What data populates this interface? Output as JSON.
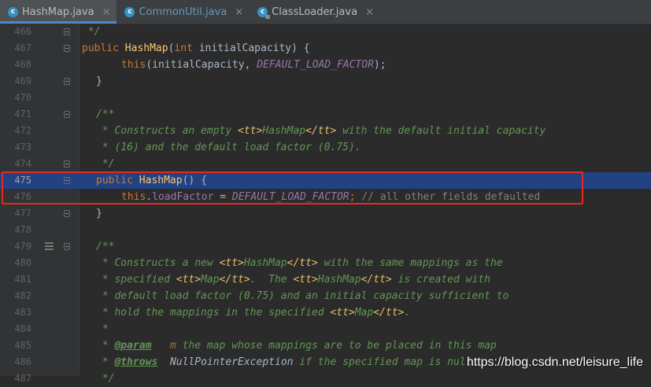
{
  "tabs": [
    {
      "label": "HashMap.java",
      "icon": "class-icon",
      "active": true
    },
    {
      "label": "CommonUtil.java",
      "icon": "class-icon",
      "active": false
    },
    {
      "label": "ClassLoader.java",
      "icon": "locked-class-icon",
      "active": false
    }
  ],
  "tab_close_glyph": "×",
  "lines": [
    {
      "num": "466"
    },
    {
      "num": "467"
    },
    {
      "num": "468"
    },
    {
      "num": "469"
    },
    {
      "num": "470"
    },
    {
      "num": "471"
    },
    {
      "num": "472"
    },
    {
      "num": "473"
    },
    {
      "num": "474"
    },
    {
      "num": "475"
    },
    {
      "num": "476"
    },
    {
      "num": "477"
    },
    {
      "num": "478"
    },
    {
      "num": "479"
    },
    {
      "num": "480"
    },
    {
      "num": "481"
    },
    {
      "num": "482"
    },
    {
      "num": "483"
    },
    {
      "num": "484"
    },
    {
      "num": "485"
    },
    {
      "num": "486"
    },
    {
      "num": "487"
    }
  ],
  "code": {
    "l466": " */",
    "l467_kw": "public ",
    "l467_fn": "HashMap",
    "l467_rest1": "(",
    "l467_kw2": "int ",
    "l467_rest2": "initialCapacity) {",
    "l468_kw": "this",
    "l468_rest1": "(initialCapacity, ",
    "l468_const": "DEFAULT_LOAD_FACTOR",
    "l468_rest2": ");",
    "l469": "}",
    "l471": "/**",
    "l472_a": " * Constructs an empty ",
    "l472_tt1": "<tt>",
    "l472_b": "HashMap",
    "l472_tt2": "</tt>",
    "l472_c": " with the default initial capacity",
    "l473": " * (16) and the default load factor (0.75).",
    "l474": " */",
    "l475_kw": "public ",
    "l475_fn": "HashMap",
    "l475_rest": "() {",
    "l476_kw": "this",
    "l476_dot": ".",
    "l476_field": "loadFactor",
    "l476_eq": " = ",
    "l476_const": "DEFAULT_LOAD_FACTOR",
    "l476_semi": "; ",
    "l476_cm": "// all other fields defaulted",
    "l477": "}",
    "l479": "/**",
    "l480_a": " * Constructs a new ",
    "l480_tt1": "<tt>",
    "l480_b": "HashMap",
    "l480_tt2": "</tt>",
    "l480_c": " with the same mappings as the",
    "l481_a": " * specified ",
    "l481_tt1": "<tt>",
    "l481_b": "Map",
    "l481_tt2": "</tt>",
    "l481_c": ".  The ",
    "l481_tt3": "<tt>",
    "l481_d": "HashMap",
    "l481_tt4": "</tt>",
    "l481_e": " is created with",
    "l482": " * default load factor (0.75) and an initial capacity sufficient to",
    "l483_a": " * hold the mappings in the specified ",
    "l483_tt1": "<tt>",
    "l483_b": "Map",
    "l483_tt2": "</tt>",
    "l483_c": ".",
    "l484": " *",
    "l485_a": " * ",
    "l485_ann": "@param",
    "l485_sp": "   ",
    "l485_p": "m",
    "l485_c": " the map whose mappings are to be placed in this map",
    "l486_a": " * ",
    "l486_ann": "@throws",
    "l486_sp": "  ",
    "l486_exc": "NullPointerException",
    "l486_c": " if the specified map is null",
    "l487": " */"
  },
  "watermark": "https://blog.csdn.net/leisure_life"
}
